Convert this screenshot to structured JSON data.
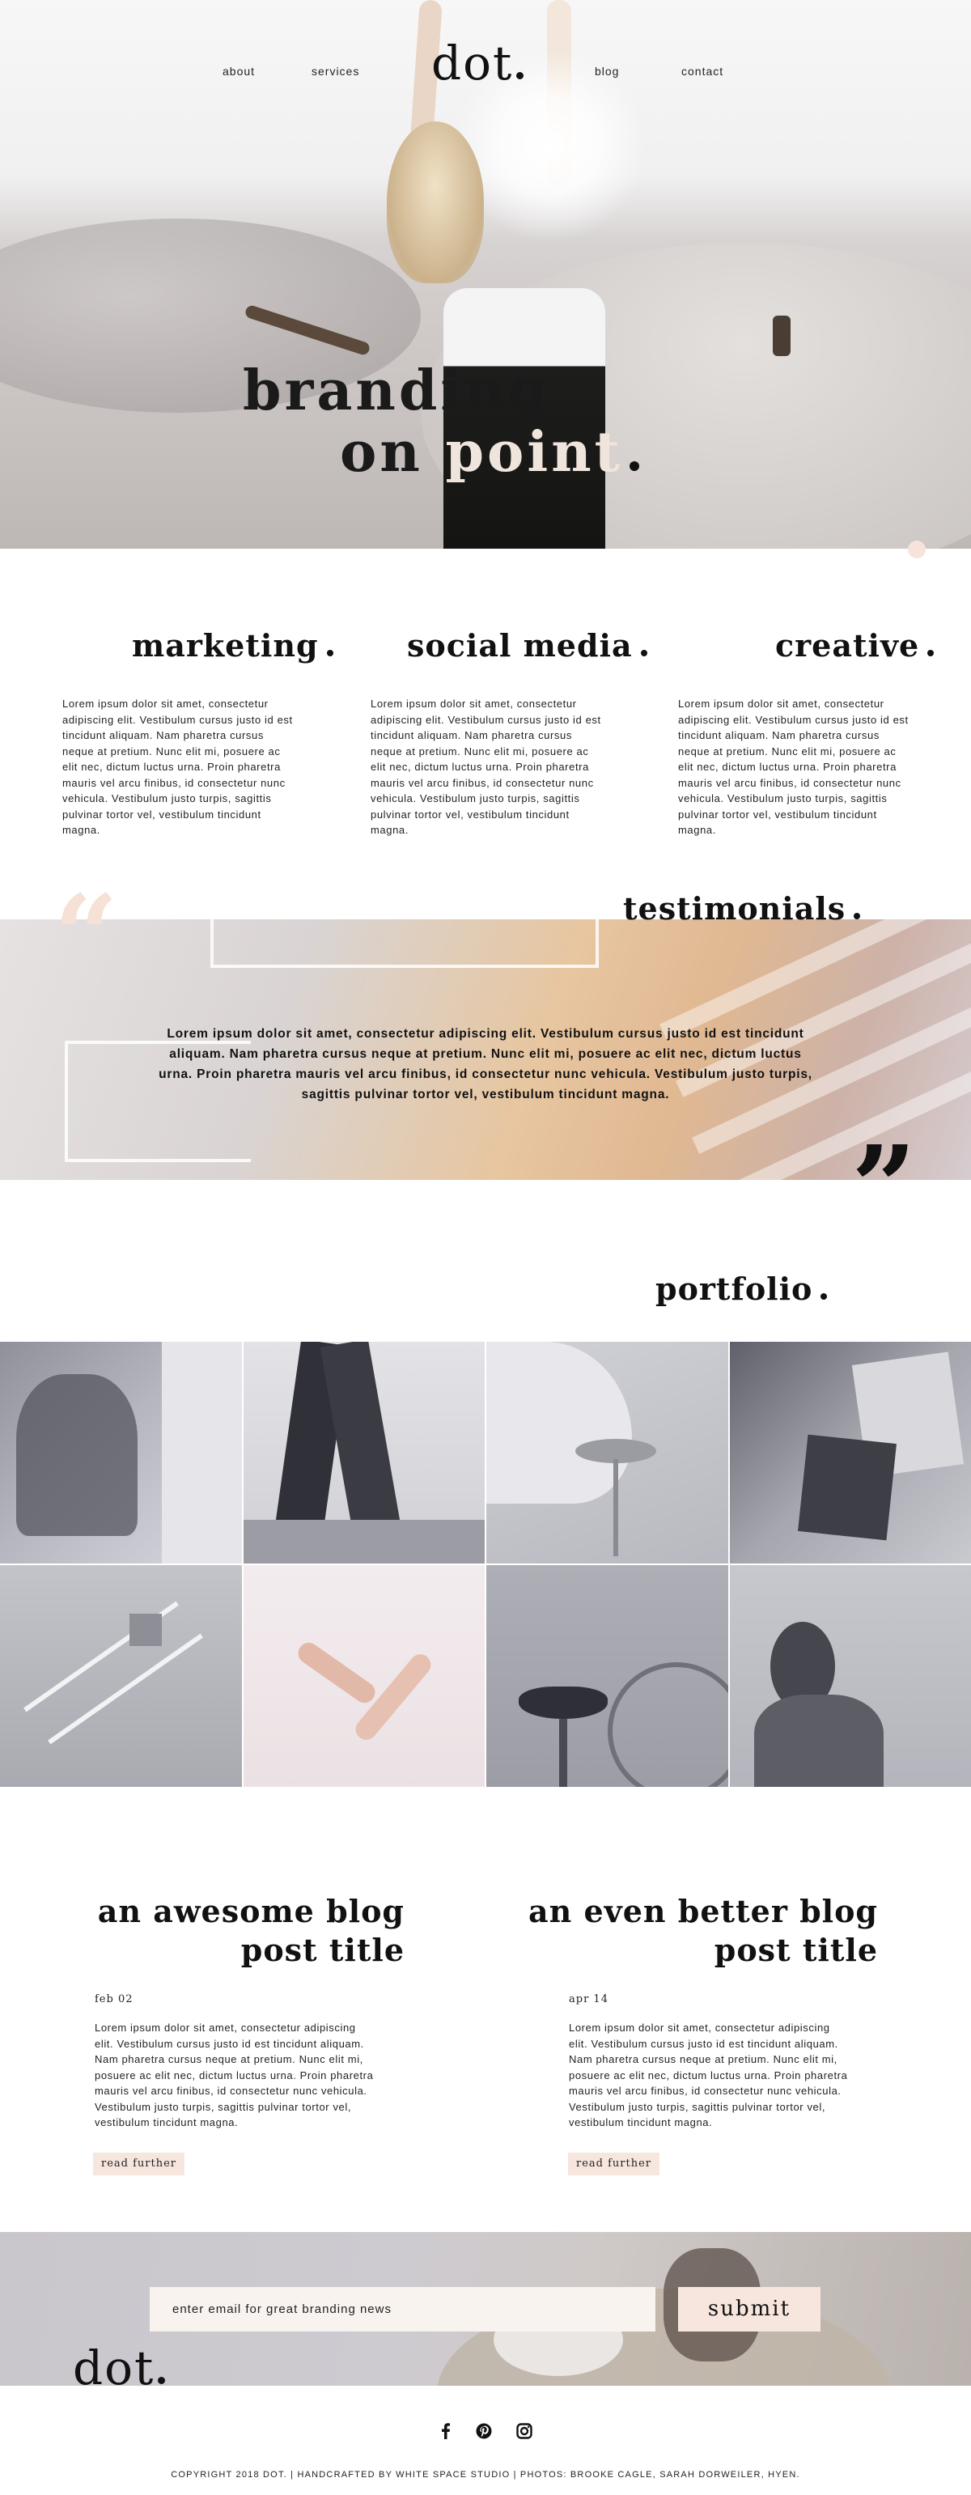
{
  "nav": {
    "links": [
      "about",
      "services",
      "blog",
      "contact"
    ],
    "logo": "dot"
  },
  "hero": {
    "line1": "branding",
    "line2_a": "on ",
    "line2_b": "point"
  },
  "services": [
    {
      "title": "marketing",
      "body": "Lorem ipsum dolor sit amet, consectetur adipiscing elit. Vestibulum cursus justo id est tincidunt aliquam. Nam pharetra cursus neque at pretium. Nunc elit mi, posuere ac elit nec, dictum luctus urna. Proin pharetra mauris vel arcu finibus, id consectetur nunc vehicula. Vestibulum justo turpis, sagittis pulvinar tortor vel, vestibulum tincidunt magna."
    },
    {
      "title": "social media",
      "body": "Lorem ipsum dolor sit amet, consectetur adipiscing elit. Vestibulum cursus justo id est tincidunt aliquam. Nam pharetra cursus neque at pretium. Nunc elit mi, posuere ac elit nec, dictum luctus urna. Proin pharetra mauris vel arcu finibus, id consectetur nunc vehicula. Vestibulum justo turpis, sagittis pulvinar tortor vel, vestibulum tincidunt magna."
    },
    {
      "title": "creative",
      "body": "Lorem ipsum dolor sit amet, consectetur adipiscing elit. Vestibulum cursus justo id est tincidunt aliquam. Nam pharetra cursus neque at pretium. Nunc elit mi, posuere ac elit nec, dictum luctus urna. Proin pharetra mauris vel arcu finibus, id consectetur nunc vehicula. Vestibulum justo turpis, sagittis pulvinar tortor vel, vestibulum tincidunt magna."
    }
  ],
  "testimonials": {
    "title": "testimonials",
    "text": "Lorem ipsum dolor sit amet, consectetur adipiscing elit. Vestibulum cursus justo id est tincidunt aliquam. Nam pharetra cursus neque at pretium. Nunc elit mi, posuere ac elit nec, dictum luctus urna. Proin pharetra mauris vel arcu finibus, id consectetur nunc vehicula. Vestibulum justo turpis, sagittis pulvinar tortor vel, vestibulum tincidunt magna."
  },
  "portfolio": {
    "title": "portfolio"
  },
  "blog": [
    {
      "title_line1": "an awesome blog",
      "title_line2": "post title",
      "date": "feb 02",
      "body": "Lorem ipsum dolor sit amet, consectetur adipiscing elit. Vestibulum cursus justo id est tincidunt aliquam. Nam pharetra cursus neque at pretium. Nunc elit mi, posuere ac elit nec, dictum luctus urna. Proin pharetra mauris vel arcu finibus, id consectetur nunc vehicula. Vestibulum justo turpis, sagittis pulvinar tortor vel, vestibulum tincidunt magna.",
      "button": "read further"
    },
    {
      "title_line1": "an even better blog",
      "title_line2": "post title",
      "date": "apr 14",
      "body": "Lorem ipsum dolor sit amet, consectetur adipiscing elit. Vestibulum cursus justo id est tincidunt aliquam. Nam pharetra cursus neque at pretium. Nunc elit mi, posuere ac elit nec, dictum luctus urna. Proin pharetra mauris vel arcu finibus, id consectetur nunc vehicula. Vestibulum justo turpis, sagittis pulvinar tortor vel, vestibulum tincidunt magna.",
      "button": "read further"
    }
  ],
  "newsletter": {
    "placeholder": "enter email for great branding news",
    "submit": "submit"
  },
  "footer": {
    "logo": "dot",
    "social_icons": [
      "facebook-icon",
      "pinterest-icon",
      "instagram-icon"
    ],
    "copyright": "COPYRIGHT 2018 DOT. | HANDCRAFTED BY WHITE SPACE STUDIO | PHOTOS: BROOKE CAGLE, SARAH DORWEILER, HYEN."
  },
  "colors": {
    "accent_pink": "#f7e6de",
    "text": "#111111",
    "hero_light_text": "#efe5dc"
  }
}
